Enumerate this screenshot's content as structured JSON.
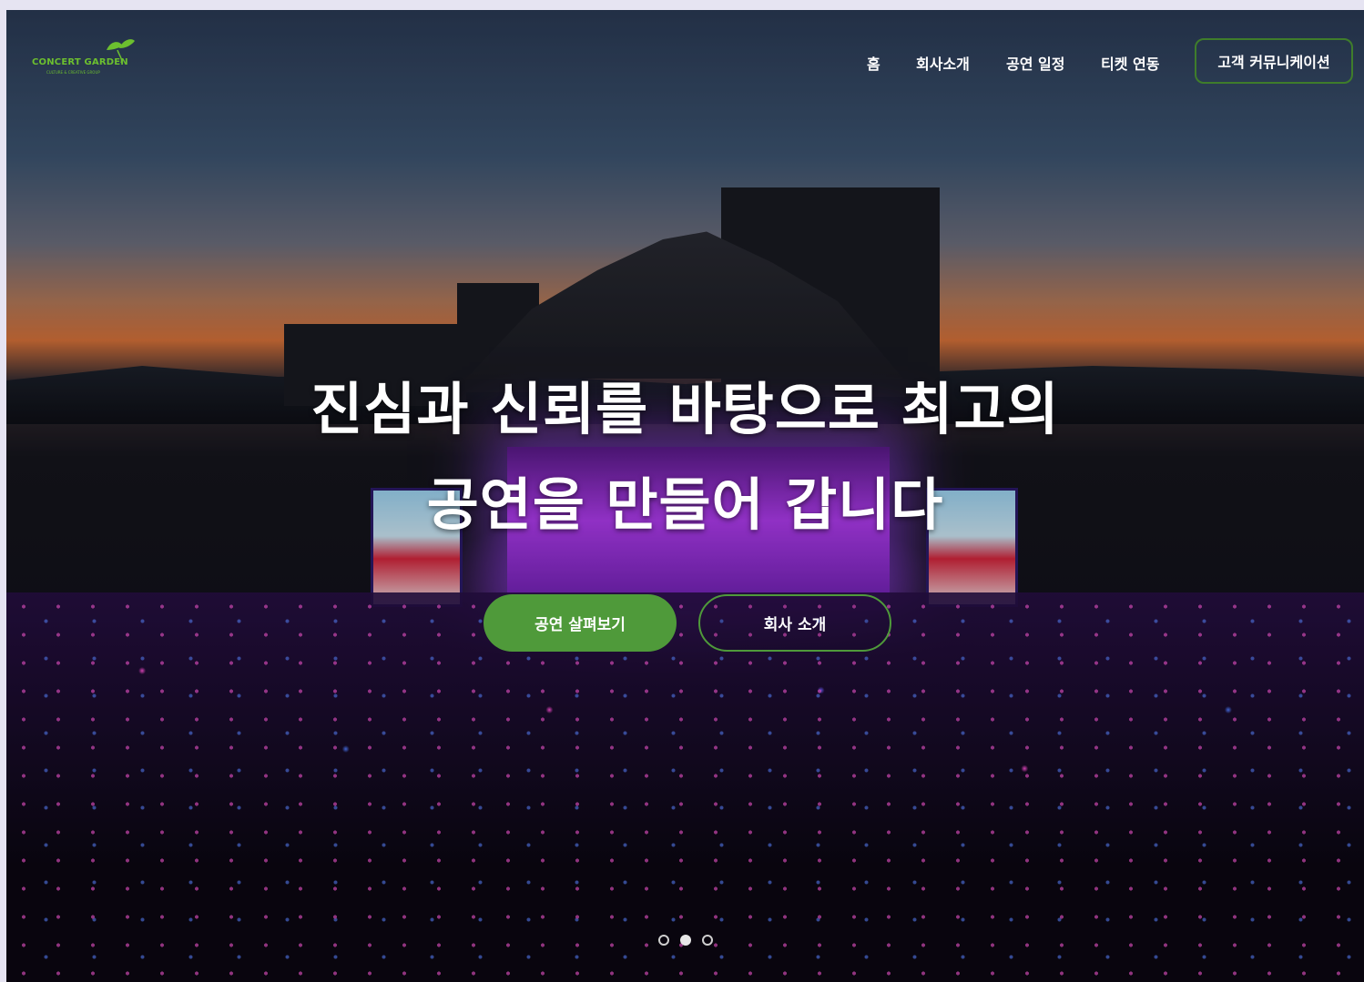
{
  "brand": {
    "name": "CONCERT GARDEN",
    "tagline": "CULTURE & CREATIVE GROUP",
    "accent_color": "#4f9a3a"
  },
  "nav": {
    "items": [
      {
        "label": "홈"
      },
      {
        "label": "회사소개"
      },
      {
        "label": "공연 일정"
      },
      {
        "label": "티켓 연동"
      }
    ],
    "cta_label": "고객 커뮤니케이션"
  },
  "hero": {
    "headline_line1": "진심과 신뢰를 바탕으로 최고의",
    "headline_line2": "공연을 만들어 갑니다",
    "primary_button": "공연 살펴보기",
    "secondary_button": "회사 소개"
  },
  "carousel": {
    "slide_count": 3,
    "active_index": 1
  }
}
